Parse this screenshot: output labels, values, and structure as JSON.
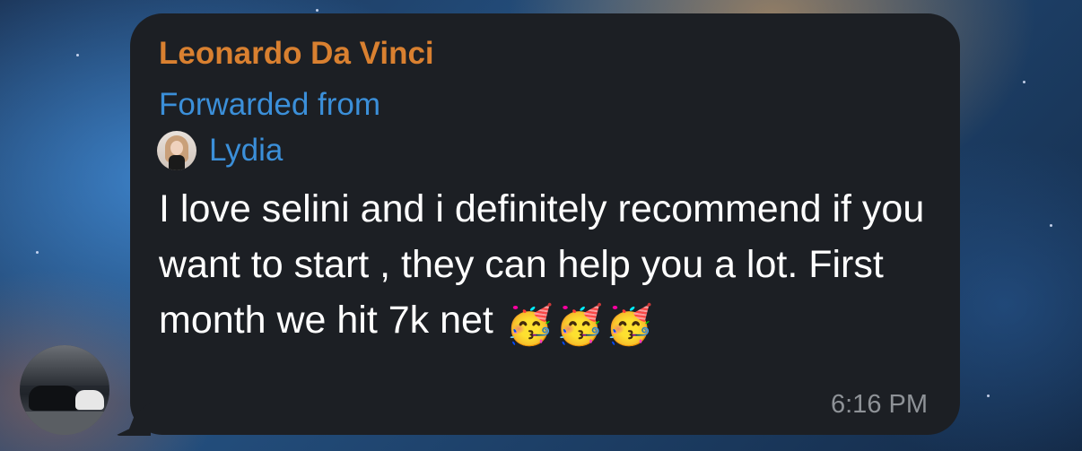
{
  "message": {
    "sender_name": "Leonardo Da Vinci",
    "forwarded_label": "Forwarded from",
    "forwarded_from_name": "Lydia",
    "text": "I love selini and i definitely recommend if you want to start , they can help you a lot. First month we hit 7k net",
    "emojis": [
      "🥳",
      "🥳",
      "🥳"
    ],
    "time": "6:16 PM"
  },
  "colors": {
    "bubble": "#1c1f24",
    "sender": "#d98030",
    "link_blue": "#3b8fd9",
    "text": "#ffffff",
    "time": "#8e9297"
  },
  "icons": {
    "sender_avatar": "avatar-garage-car",
    "forward_avatar": "avatar-lydia"
  }
}
